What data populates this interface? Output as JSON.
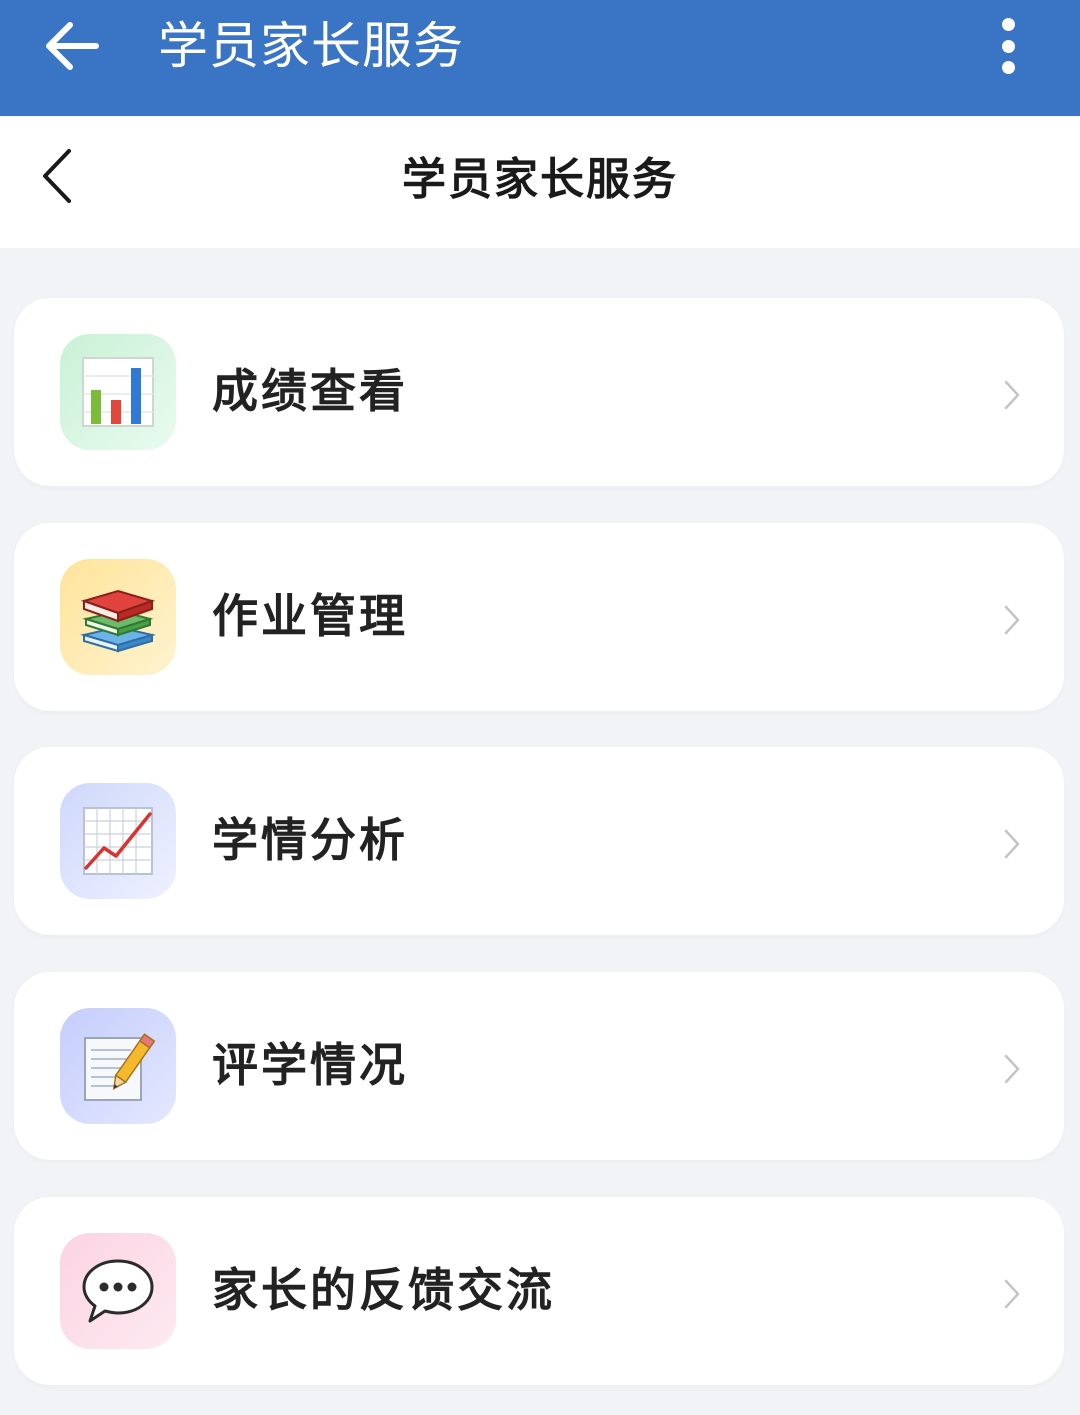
{
  "appbar": {
    "title": "学员家长服务",
    "back_icon": "arrow-left-icon",
    "more_icon": "more-vertical-icon",
    "color": "#3a74c4"
  },
  "page_header": {
    "title": "学员家长服务",
    "back_icon": "chevron-left-icon"
  },
  "menu": {
    "items": [
      {
        "label": "成绩查看",
        "icon": "bar-chart-icon",
        "icon_bg": "#c9f1d6"
      },
      {
        "label": "作业管理",
        "icon": "books-icon",
        "icon_bg": "#ffe39a"
      },
      {
        "label": "学情分析",
        "icon": "trend-chart-icon",
        "icon_bg": "#cfd8fb"
      },
      {
        "label": "评学情况",
        "icon": "memo-pencil-icon",
        "icon_bg": "#c5cdfb"
      },
      {
        "label": "家长的反馈交流",
        "icon": "speech-bubble-icon",
        "icon_bg": "#fbd3e2"
      }
    ],
    "chevron_icon": "chevron-right-icon"
  }
}
